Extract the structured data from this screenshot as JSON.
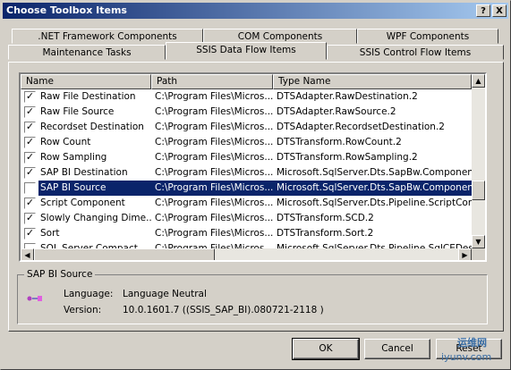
{
  "window": {
    "title": "Choose Toolbox Items"
  },
  "tabs_row1": [
    ".NET Framework Components",
    "COM Components",
    "WPF Components"
  ],
  "tabs_row2": [
    "Maintenance Tasks",
    "SSIS Data Flow Items",
    "SSIS Control Flow Items"
  ],
  "active_tab": "SSIS Data Flow Items",
  "columns": [
    "Name",
    "Path",
    "Type Name"
  ],
  "rows": [
    {
      "name": "Raw File Destination",
      "path": "C:\\Program Files\\Micros...",
      "type": "DTSAdapter.RawDestination.2",
      "checked": true
    },
    {
      "name": "Raw File Source",
      "path": "C:\\Program Files\\Micros...",
      "type": "DTSAdapter.RawSource.2",
      "checked": true
    },
    {
      "name": "Recordset Destination",
      "path": "C:\\Program Files\\Micros...",
      "type": "DTSAdapter.RecordsetDestination.2",
      "checked": true
    },
    {
      "name": "Row Count",
      "path": "C:\\Program Files\\Micros...",
      "type": "DTSTransform.RowCount.2",
      "checked": true
    },
    {
      "name": "Row Sampling",
      "path": "C:\\Program Files\\Micros...",
      "type": "DTSTransform.RowSampling.2",
      "checked": true
    },
    {
      "name": "SAP BI Destination",
      "path": "C:\\Program Files\\Micros...",
      "type": "Microsoft.SqlServer.Dts.SapBw.Components.",
      "checked": true
    },
    {
      "name": "SAP BI Source",
      "path": "C:\\Program Files\\Micros...",
      "type": "Microsoft.SqlServer.Dts.SapBw.Components.",
      "checked": true,
      "selected": true
    },
    {
      "name": "Script Component",
      "path": "C:\\Program Files\\Micros...",
      "type": "Microsoft.SqlServer.Dts.Pipeline.ScriptCompo",
      "checked": true
    },
    {
      "name": "Slowly Changing Dime...",
      "path": "C:\\Program Files\\Micros...",
      "type": "DTSTransform.SCD.2",
      "checked": true
    },
    {
      "name": "Sort",
      "path": "C:\\Program Files\\Micros...",
      "type": "DTSTransform.Sort.2",
      "checked": true
    },
    {
      "name": "SQL Server Compact",
      "path": "C:\\Program Files\\Micros...",
      "type": "Microsoft.SqlServer.Dts.Pipeline.SqlCEDestina",
      "checked": false
    }
  ],
  "details": {
    "group_title": "SAP BI Source",
    "language_label": "Language:",
    "language_value": "Language Neutral",
    "version_label": "Version:",
    "version_value": "10.0.1601.7 ((SSIS_SAP_BI).080721-2118 )"
  },
  "buttons": {
    "ok": "OK",
    "cancel": "Cancel",
    "reset": "Reset"
  },
  "titlebar_buttons": {
    "help": "?",
    "close": "X"
  },
  "watermark": {
    "line1": "运维网",
    "line2": "iyunv.com"
  }
}
